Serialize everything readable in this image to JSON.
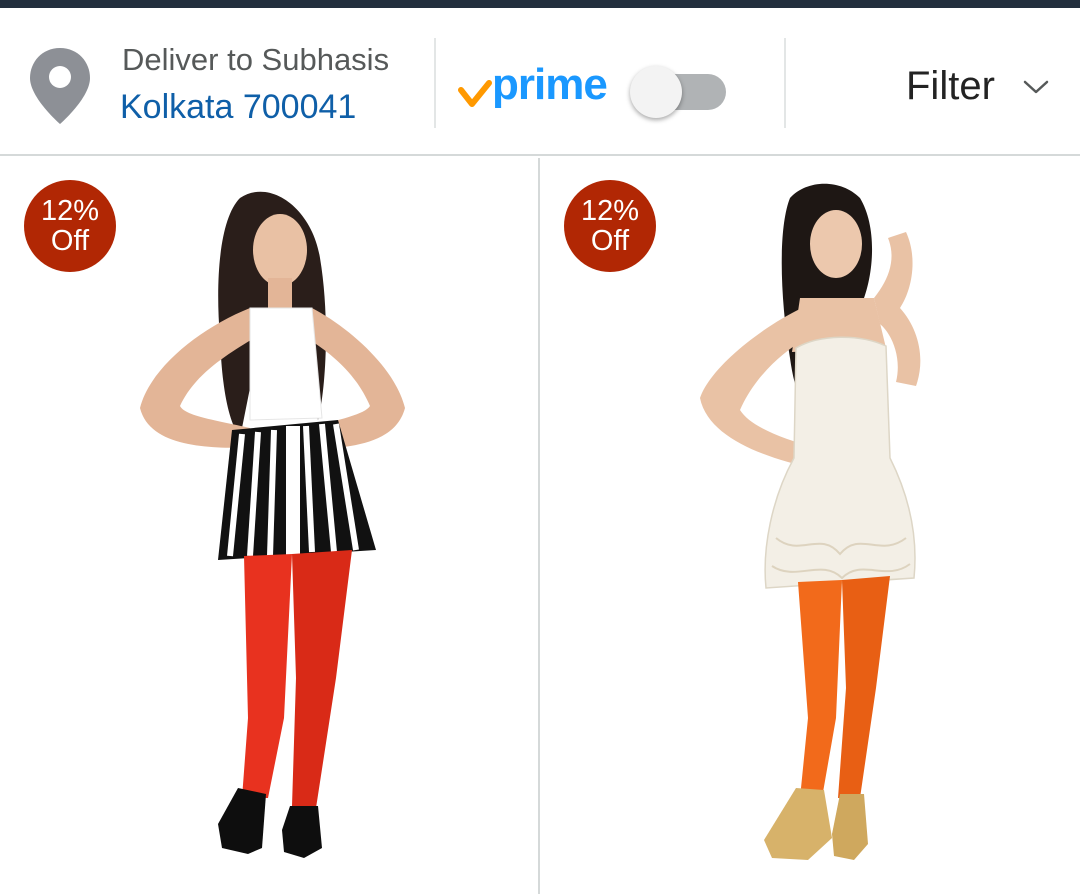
{
  "location": {
    "line1": "Deliver to Subhasis",
    "line2": "Kolkata 700041"
  },
  "prime": {
    "label": "prime",
    "toggle_state": "off"
  },
  "filter": {
    "label": "Filter"
  },
  "products": [
    {
      "discount_pct": "12%",
      "discount_off": "Off",
      "top_color": "#ffffff",
      "legging_color": "#e8321f"
    },
    {
      "discount_pct": "12%",
      "discount_off": "Off",
      "top_color": "#f3efe6",
      "legging_color": "#f26a1b"
    }
  ],
  "colors": {
    "header_bar": "#232f3e",
    "link_blue": "#0f5fa8",
    "prime_blue": "#1a98ff",
    "prime_check": "#ff9900",
    "badge": "#b12704"
  }
}
